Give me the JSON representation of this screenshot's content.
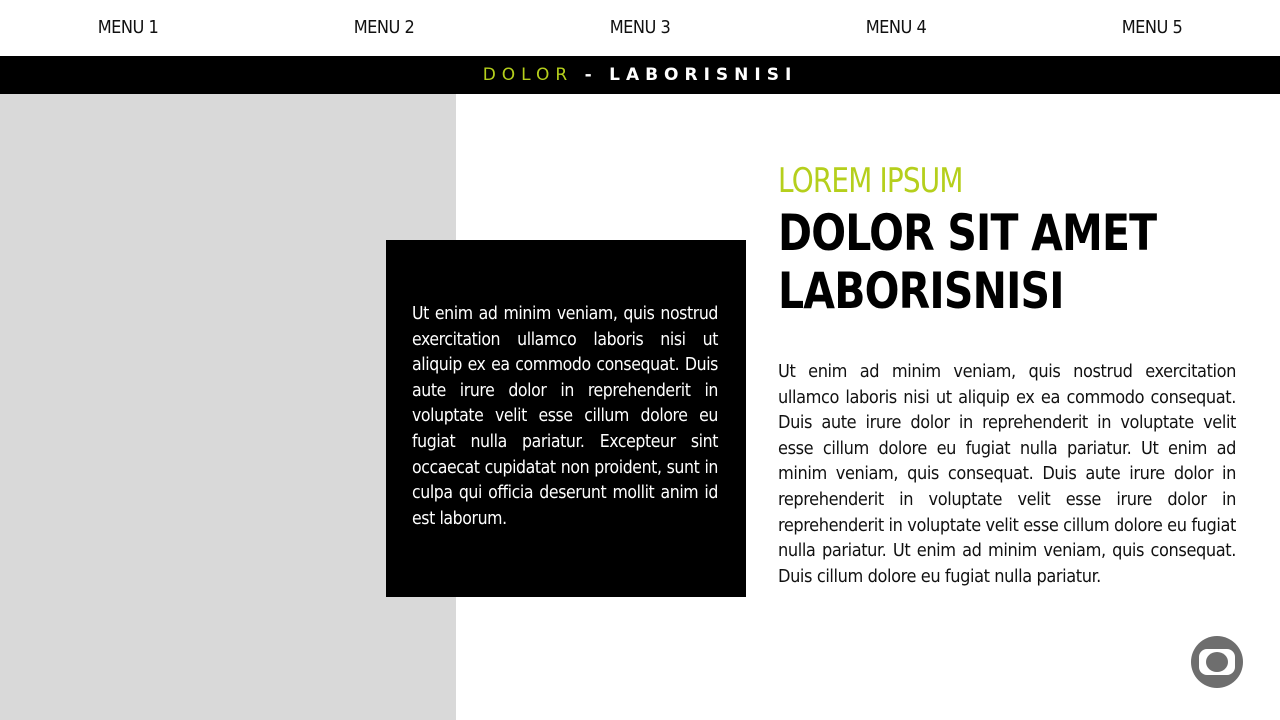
{
  "nav": {
    "items": [
      {
        "label": "MENU 1"
      },
      {
        "label": "MENU 2"
      },
      {
        "label": "MENU 3"
      },
      {
        "label": "MENU 4"
      },
      {
        "label": "MENU 5"
      }
    ]
  },
  "banner": {
    "accent": "DOLOR",
    "separator": "-",
    "main": "LABORISNISI",
    "accent_color": "#b5cf1c"
  },
  "callout": {
    "text": "Ut enim ad minim veniam, quis nostrud exercitation ullamco laboris nisi ut aliquip ex ea commodo consequat. Duis aute irure dolor in reprehenderit in voluptate velit esse cillum dolore eu fugiat nulla pariatur. Excepteur sint occaecat cupidatat non proident, sunt in culpa qui officia deserunt mollit anim id est laborum."
  },
  "article": {
    "eyebrow": "LOREM IPSUM",
    "headline_line1": "DOLOR SIT AMET",
    "headline_line2": "LABORISNISI",
    "body": "Ut enim ad minim veniam, quis nostrud exercitation ullamco laboris nisi ut aliquip ex ea commodo consequat. Duis aute irure dolor in reprehenderit in voluptate velit esse cillum dolore eu fugiat nulla pariatur. Ut enim ad minim veniam, quis consequat. Duis aute irure dolor in reprehenderit in voluptate velit esse irure dolor in reprehenderit in voluptate velit esse cillum dolore eu fugiat nulla pariatur. Ut enim ad minim veniam, quis consequat. Duis cillum dolore eu fugiat nulla pariatur."
  },
  "logo": {
    "icon": "globo-logo-icon"
  }
}
